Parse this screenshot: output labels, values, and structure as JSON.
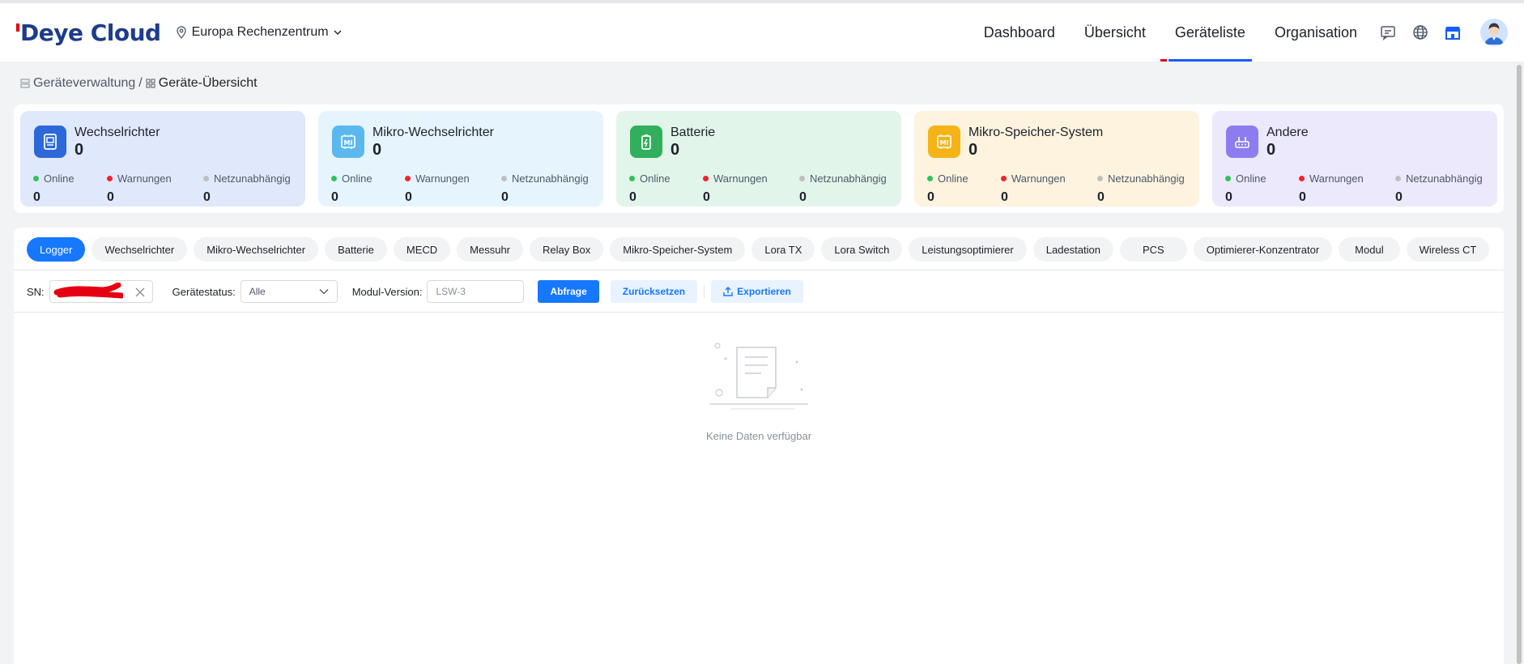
{
  "header": {
    "logo": "Deye Cloud",
    "region": "Europa Rechenzentrum",
    "nav": [
      {
        "label": "Dashboard"
      },
      {
        "label": "Übersicht"
      },
      {
        "label": "Geräteliste"
      },
      {
        "label": "Organisation"
      }
    ]
  },
  "breadcrumb": {
    "parent": "Geräteverwaltung",
    "separator": "/",
    "current": "Geräte-Übersicht"
  },
  "cards": [
    {
      "title": "Wechselrichter",
      "total": "0",
      "online_label": "Online",
      "online": "0",
      "warn_label": "Warnungen",
      "warn": "0",
      "offgrid_label": "Netzunabhängig",
      "offgrid": "0",
      "icon": "inverter-icon",
      "bg": "#e0e9fb",
      "icon_bg": "#2d68d8"
    },
    {
      "title": "Mikro-Wechselrichter",
      "total": "0",
      "online_label": "Online",
      "online": "0",
      "warn_label": "Warnungen",
      "warn": "0",
      "offgrid_label": "Netzunabhängig",
      "offgrid": "0",
      "icon": "micro-inverter-icon",
      "bg": "#e6f4fd",
      "icon_bg": "#5bb8ef"
    },
    {
      "title": "Batterie",
      "total": "0",
      "online_label": "Online",
      "online": "0",
      "warn_label": "Warnungen",
      "warn": "0",
      "offgrid_label": "Netzunabhängig",
      "offgrid": "0",
      "icon": "battery-icon",
      "bg": "#e2f5ea",
      "icon_bg": "#30b05c"
    },
    {
      "title": "Mikro-Speicher-System",
      "total": "0",
      "online_label": "Online",
      "online": "0",
      "warn_label": "Warnungen",
      "warn": "0",
      "offgrid_label": "Netzunabhängig",
      "offgrid": "0",
      "icon": "micro-storage-icon",
      "bg": "#fdf3df",
      "icon_bg": "#f5b316"
    },
    {
      "title": "Andere",
      "total": "0",
      "online_label": "Online",
      "online": "0",
      "warn_label": "Warnungen",
      "warn": "0",
      "offgrid_label": "Netzunabhängig",
      "offgrid": "0",
      "icon": "router-icon",
      "bg": "#ebe9fb",
      "icon_bg": "#8c7cf0"
    }
  ],
  "colors": {
    "online": "#2fc25b",
    "warn": "#f5222d",
    "offgrid": "#bfbfbf",
    "primary": "#1677ff"
  },
  "tabs": [
    {
      "label": "Logger",
      "active": true
    },
    {
      "label": "Wechselrichter"
    },
    {
      "label": "Mikro-Wechselrichter"
    },
    {
      "label": "Batterie"
    },
    {
      "label": "MECD"
    },
    {
      "label": "Messuhr"
    },
    {
      "label": "Relay Box"
    },
    {
      "label": "Mikro-Speicher-System"
    },
    {
      "label": "Lora TX"
    },
    {
      "label": "Lora Switch"
    },
    {
      "label": "Leistungsoptimierer"
    },
    {
      "label": "Ladestation"
    },
    {
      "label": "PCS"
    },
    {
      "label": "Optimierer-Konzentrator"
    },
    {
      "label": "Modul"
    },
    {
      "label": "Wireless CT"
    }
  ],
  "filters": {
    "sn_label": "SN:",
    "status_label": "Gerätestatus:",
    "status_value": "Alle",
    "module_label": "Modul-Version:",
    "module_value": "LSW-3",
    "query": "Abfrage",
    "reset": "Zurücksetzen",
    "export": "Exportieren"
  },
  "empty": {
    "text": "Keine Daten verfügbar"
  }
}
